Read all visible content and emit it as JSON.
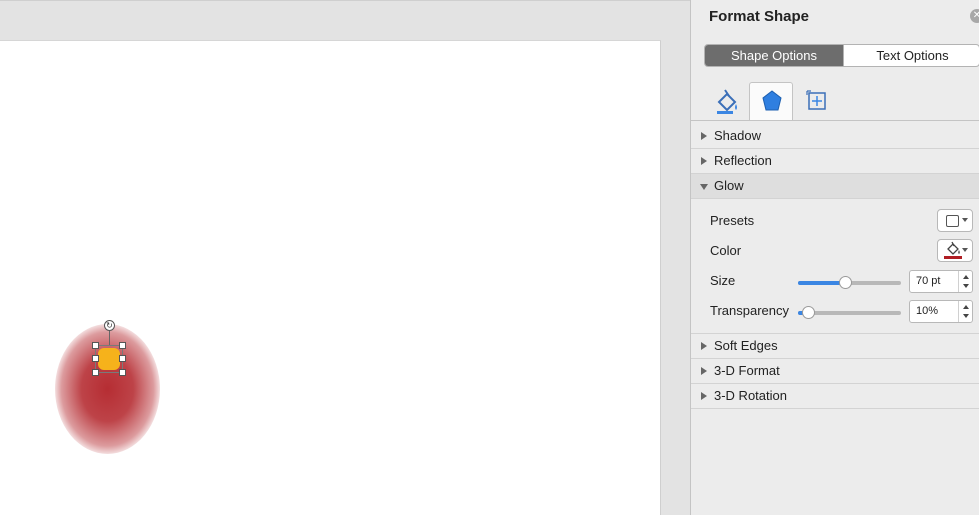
{
  "pane": {
    "title": "Format Shape",
    "close_icon": "close-icon",
    "segments": {
      "shape_options": "Shape Options",
      "text_options": "Text Options",
      "active": "shape_options"
    },
    "icon_tabs": [
      {
        "name": "fill-line-icon",
        "active": false
      },
      {
        "name": "effects-icon",
        "active": true
      },
      {
        "name": "size-properties-icon",
        "active": false
      }
    ],
    "sections": {
      "shadow": "Shadow",
      "reflection": "Reflection",
      "glow": "Glow",
      "soft_edges": "Soft Edges",
      "format_3d": "3-D Format",
      "rotation_3d": "3-D Rotation"
    },
    "glow": {
      "presets_label": "Presets",
      "color_label": "Color",
      "color_value": "#b01e24",
      "size_label": "Size",
      "size_value": "70 pt",
      "size_slider_fraction": 0.46,
      "transparency_label": "Transparency",
      "transparency_value": "10%",
      "transparency_slider_fraction": 0.1
    }
  },
  "canvas": {
    "shape_color": "#f6b21b",
    "glow_color": "#b22228"
  },
  "colors": {
    "accent": "#3b86e3",
    "active_segment": "#6d6d6d"
  }
}
